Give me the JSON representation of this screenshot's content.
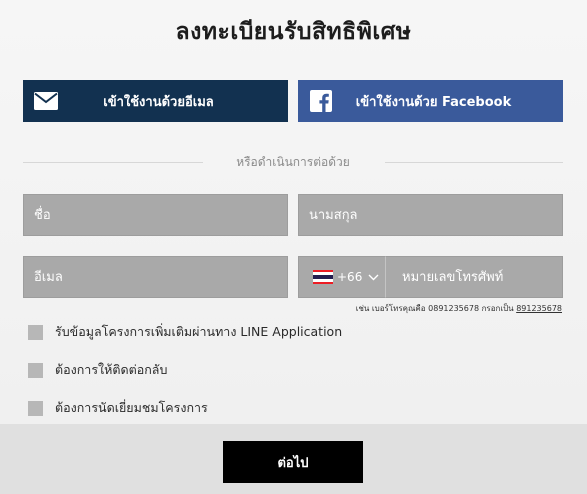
{
  "title": "ลงทะเบียนรับสิทธิพิเศษ",
  "login": {
    "email_label": "เข้าใช้งานด้วยอีเมล",
    "facebook_label": "เข้าใช้งานด้วย Facebook"
  },
  "divider_text": "หรือดำเนินการต่อด้วย",
  "form": {
    "first_name_placeholder": "ชื่อ",
    "last_name_placeholder": "นามสกุล",
    "email_placeholder": "อีเมล",
    "country_code": "+66",
    "phone_placeholder": "หมายเลขโทรศัพท์",
    "phone_hint_prefix": "เช่น เบอร์โทรคุณคือ 0891235678 กรอกเป็น ",
    "phone_hint_example": "891235678"
  },
  "checkboxes": [
    "รับข้อมูลโครงการเพิ่มเติมผ่านทาง LINE Application",
    "ต้องการให้ติดต่อกลับ",
    "ต้องการนัดเยี่ยมชมโครงการ"
  ],
  "next_label": "ต่อไป",
  "colors": {
    "email_button": "#123150",
    "facebook_button": "#3a5a9b",
    "field_bg": "#a9a9a9",
    "next_button": "#000000"
  },
  "icons": {
    "email": "envelope-icon",
    "facebook": "facebook-icon",
    "flag": "thailand-flag-icon",
    "dropdown": "chevron-down-icon"
  }
}
